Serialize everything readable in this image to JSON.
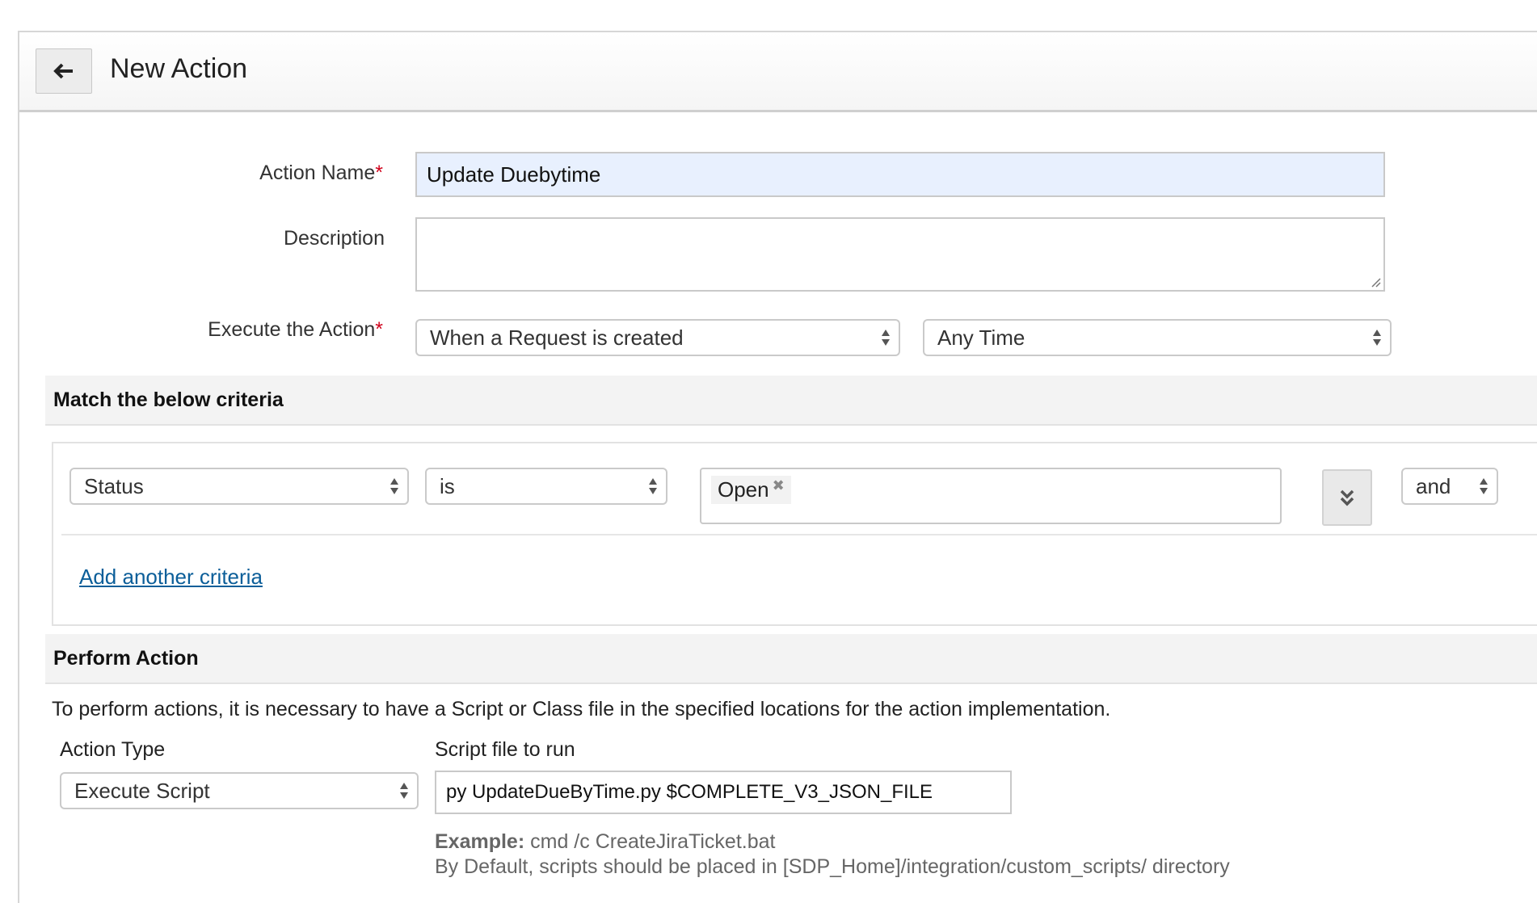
{
  "header": {
    "title": "New Action"
  },
  "form": {
    "action_name_label": "Action Name",
    "required_mark": "*",
    "action_name_value": "Update Duebytime",
    "description_label": "Description",
    "description_value": "",
    "execute_label": "Execute the Action",
    "execute_when": "When a Request is created",
    "execute_time": "Any Time"
  },
  "criteria": {
    "section_title": "Match the below criteria",
    "field": "Status",
    "operator": "is",
    "value_tag": "Open",
    "tag_remove_icon": "close-icon",
    "expand_icon": "double-chevron-down-icon",
    "conjunction": "and",
    "add_link": "Add another criteria"
  },
  "perform": {
    "section_title": "Perform Action",
    "info": "To perform actions, it is necessary to have a Script or Class file in the specified locations for the action implementation.",
    "action_type_label": "Action Type",
    "action_type_value": "Execute Script",
    "script_label": "Script file to run",
    "script_value": "py UpdateDueByTime.py $COMPLETE_V3_JSON_FILE",
    "example_label": "Example:",
    "example_value": "cmd /c CreateJiraTicket.bat",
    "default_note": "By Default, scripts should be placed in [SDP_Home]/integration/custom_scripts/ directory"
  },
  "colors": {
    "accent_link": "#0b5e99",
    "required": "#d0021b",
    "input_highlight": "#e8f0fe"
  }
}
